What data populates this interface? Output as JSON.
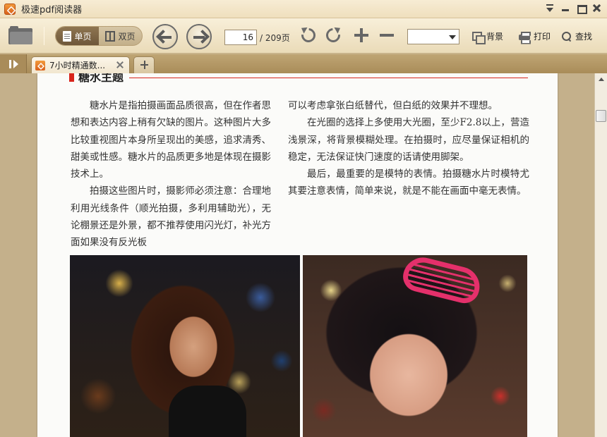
{
  "app": {
    "title": "极速pdf阅读器"
  },
  "toolbar": {
    "single_page_label": "单页",
    "double_page_label": "双页",
    "current_page": "16",
    "total_pages": "/ 209页",
    "zoom_value": "",
    "background_label": "背景",
    "print_label": "打印",
    "search_label": "查找"
  },
  "tabs": [
    {
      "label": "7小时精通数..."
    }
  ],
  "document": {
    "section_title": "糖水主题",
    "left_column": [
      {
        "text": "糖水片是指拍摄画面品质很高，但在作者思想和表达内容上稍有欠缺的图片。这种图片大多比较重视图片本身所呈现出的美感，追求清秀、甜美或性感。糖水片的品质更多地是体现在摄影技术上。"
      },
      {
        "text": "拍摄这些图片时，摄影师必须注意：合理地利用光线条件（顺光拍摄，多利用辅助光），无论棚景还是外景，都不推荐使用闪光灯，补光方面如果没有反光板"
      }
    ],
    "right_column": [
      {
        "text": "可以考虑拿张白纸替代，但白纸的效果并不理想。"
      },
      {
        "text": "在光圈的选择上多使用大光圈，至少F2.8以上，营造浅景深，将背景模糊处理。在拍摄时，应尽量保证相机的稳定，无法保证快门速度的话请使用脚架。"
      },
      {
        "text": "最后，最重要的是模特的表情。拍摄糖水片时模特尤其要注意表情，简单来说，就是不能在画面中毫无表情。"
      }
    ]
  },
  "colors": {
    "accent_red": "#d8241b",
    "toolbar_bg": "#efdfbd",
    "viewer_bg": "#c4b08b"
  }
}
